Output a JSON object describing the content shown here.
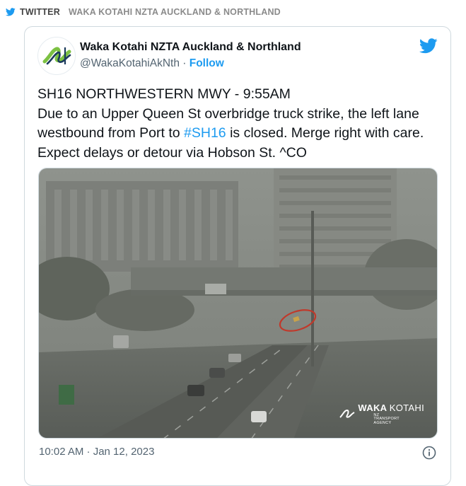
{
  "source": {
    "platform": "TWITTER",
    "account_label": "WAKA KOTAHI NZTA AUCKLAND & NORTHLAND"
  },
  "tweet": {
    "author_name": "Waka Kotahi NZTA Auckland & Northland",
    "handle": "@WakaKotahiAkNth",
    "separator": " · ",
    "follow_label": "Follow",
    "text_line1": "SH16 NORTHWESTERN MWY - 9:55AM",
    "text_line2_pre": "Due to an Upper Queen St overbridge truck strike, the left lane westbound from Port to ",
    "hashtag": "#SH16",
    "text_line2_post": " is closed. Merge right with care. Expect delays or detour via Hobson St. ^CO",
    "timestamp": "10:02 AM · Jan 12, 2023"
  },
  "media": {
    "watermark_brand_bold": "WAKA",
    "watermark_brand_light": "KOTAHI",
    "watermark_sub": "NZ TRANSPORT AGENCY"
  },
  "colors": {
    "twitter_blue": "#1d9bf0",
    "annotation_red": "#c0392b",
    "logo_green": "#7cc142",
    "logo_navy": "#1b3a5c"
  },
  "icons": {
    "source": "twitter-bird-icon",
    "logo": "twitter-bird-icon",
    "info": "info-icon",
    "avatar": "waka-kotahi-logo"
  }
}
